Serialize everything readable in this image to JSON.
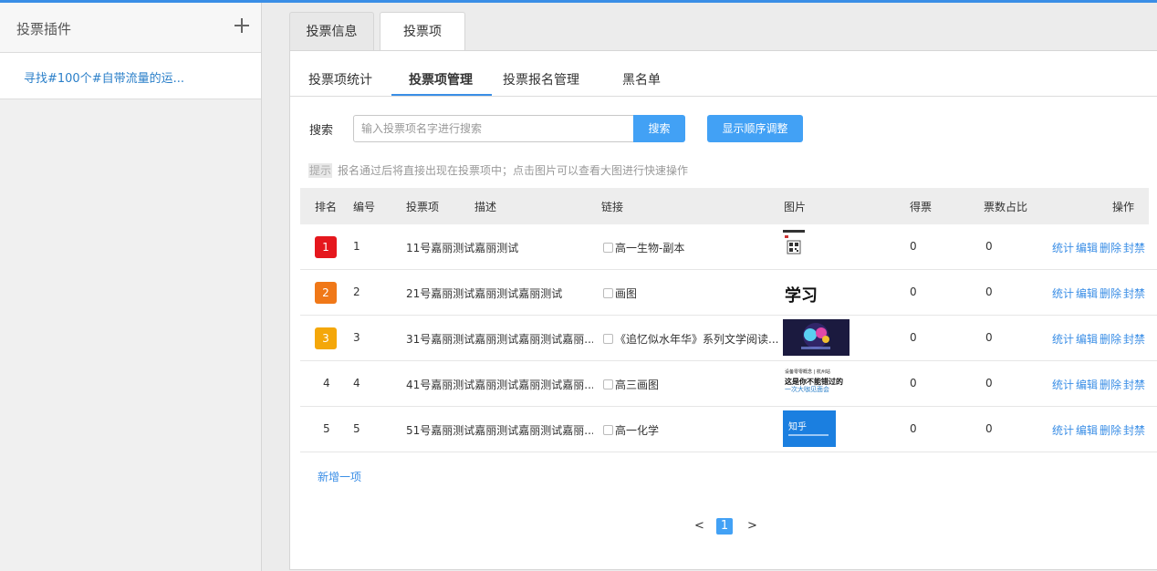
{
  "sidebar": {
    "title": "投票插件",
    "items": [
      {
        "label": "寻找#100个#自带流量的运..."
      }
    ]
  },
  "tabs": [
    {
      "label": "投票信息"
    },
    {
      "label": "投票项"
    }
  ],
  "subtabs": [
    {
      "label": "投票项统计"
    },
    {
      "label": "投票项管理"
    },
    {
      "label": "投票报名管理"
    },
    {
      "label": "黑名单"
    }
  ],
  "search": {
    "label": "搜索",
    "placeholder": "输入投票项名字进行搜索",
    "button": "搜索",
    "order_button": "显示顺序调整"
  },
  "hint": {
    "tag": "提示",
    "text": "报名通过后将直接出现在投票项中；点击图片可以查看大图进行快速操作"
  },
  "table": {
    "headers": {
      "rank": "排名",
      "no": "编号",
      "item": "投票项",
      "desc": "描述",
      "link": "链接",
      "image": "图片",
      "votes": "得票",
      "ratio": "票数占比",
      "ops": "操作"
    },
    "rows": [
      {
        "rank": "1",
        "no": "1",
        "item": "11号嘉丽测试嘉丽测试",
        "link": "高一生物-副本",
        "votes": "0",
        "ratio": "0",
        "rank_color": "#e5171d"
      },
      {
        "rank": "2",
        "no": "2",
        "item": "21号嘉丽测试嘉丽测试嘉丽测试",
        "link": "画图",
        "votes": "0",
        "ratio": "0",
        "rank_color": "#f07818"
      },
      {
        "rank": "3",
        "no": "3",
        "item": "31号嘉丽测试嘉丽测试嘉丽测试嘉丽...",
        "link": "《追忆似水年华》系列文学阅读...",
        "votes": "0",
        "ratio": "0",
        "rank_color": "#f4a70a"
      },
      {
        "rank": "4",
        "no": "4",
        "item": "41号嘉丽测试嘉丽测试嘉丽测试嘉丽...",
        "link": "高三画图",
        "votes": "0",
        "ratio": "0"
      },
      {
        "rank": "5",
        "no": "5",
        "item": "51号嘉丽测试嘉丽测试嘉丽测试嘉丽...",
        "link": "高一化学",
        "votes": "0",
        "ratio": "0"
      }
    ],
    "ops": {
      "stats": "统计",
      "edit": "编辑",
      "delete": "删除",
      "ban": "封禁"
    }
  },
  "thumbs": {
    "row2_text": "学习",
    "row4_line1": "设备零零概念 | 杭州站",
    "row4_line2": "这是你不能错过的",
    "row4_line3": "一次大咖见面会",
    "row5_text": "知乎"
  },
  "add_item": "新增一项",
  "pager": {
    "prev": "<",
    "current": "1",
    "next": ">"
  },
  "colors": {
    "accent": "#42a1f5",
    "link": "#3a8ee6"
  }
}
